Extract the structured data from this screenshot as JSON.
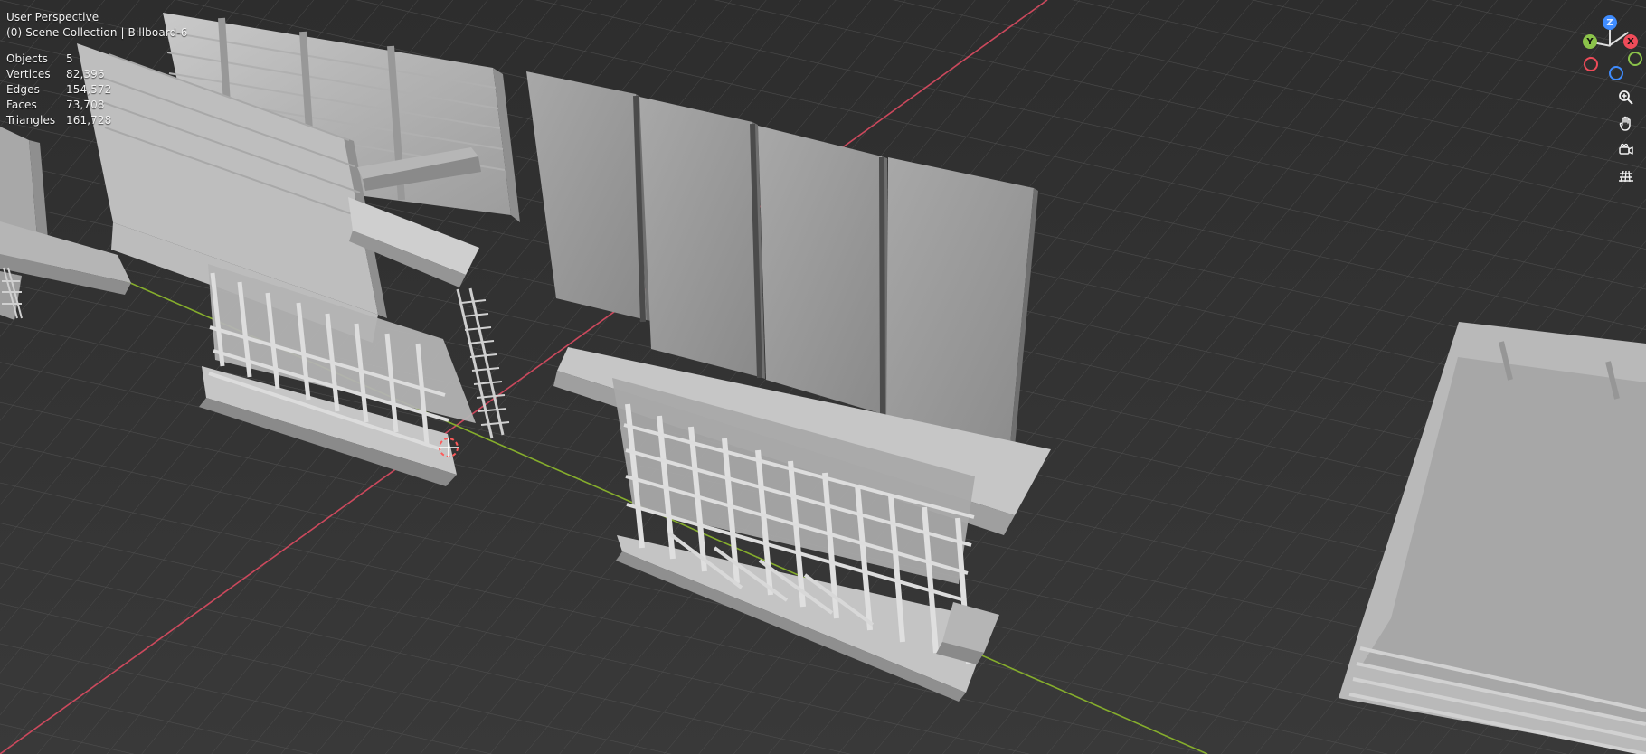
{
  "viewport": {
    "title": "User Perspective",
    "collection_path": "(0) Scene Collection | Billboard-6"
  },
  "stats": [
    {
      "label": "Objects",
      "value": "5"
    },
    {
      "label": "Vertices",
      "value": "82,396"
    },
    {
      "label": "Edges",
      "value": "154,572"
    },
    {
      "label": "Faces",
      "value": "73,708"
    },
    {
      "label": "Triangles",
      "value": "161,728"
    }
  ],
  "gizmo": {
    "x_label": "X",
    "y_label": "Y",
    "z_label": "Z"
  },
  "tools": [
    {
      "name": "zoom-icon"
    },
    {
      "name": "hand-icon"
    },
    {
      "name": "camera-icon"
    },
    {
      "name": "grid-icon"
    }
  ]
}
